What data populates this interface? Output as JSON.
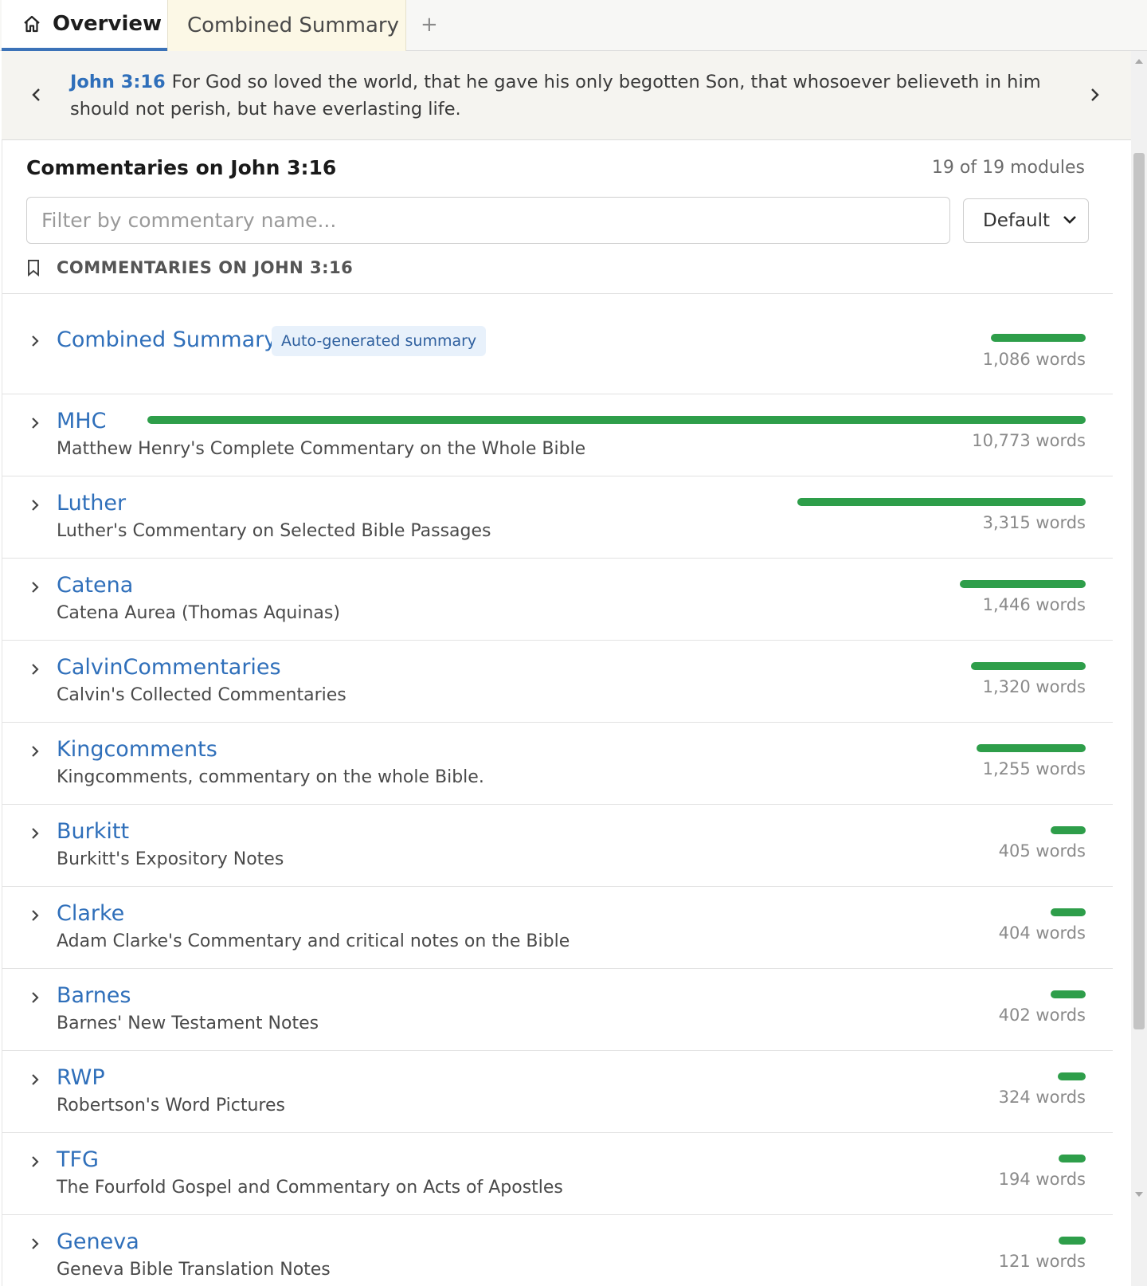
{
  "tabs": {
    "overview_label": "Overview",
    "summary_label": "Combined Summary",
    "add_label": "+"
  },
  "verse": {
    "reference": "John 3:16",
    "text": "For God so loved the world, that he gave his only begotten Son, that whosoever believeth in him should not perish, but have everlasting life."
  },
  "panel": {
    "title": "Commentaries on John 3:16",
    "module_count": "19 of 19 modules",
    "filter_placeholder": "Filter by commentary name...",
    "sort_value": "Default",
    "section_heading": "COMMENTARIES ON JOHN 3:16"
  },
  "accent_color": "#2f6fba",
  "bar_color": "#2e9e4a",
  "commentaries": [
    {
      "name": "Combined Summary",
      "badge": "Auto-generated summary",
      "words": "1,086 words",
      "word_count": 1086
    },
    {
      "name": "MHC",
      "description": "Matthew Henry's Complete Commentary on the Whole Bible",
      "words": "10,773 words",
      "word_count": 10773
    },
    {
      "name": "Luther",
      "description": "Luther's Commentary on Selected Bible Passages",
      "words": "3,315 words",
      "word_count": 3315
    },
    {
      "name": "Catena",
      "description": "Catena Aurea (Thomas Aquinas)",
      "words": "1,446 words",
      "word_count": 1446
    },
    {
      "name": "CalvinCommentaries",
      "description": "Calvin's Collected Commentaries",
      "words": "1,320 words",
      "word_count": 1320
    },
    {
      "name": "Kingcomments",
      "description": "Kingcomments, commentary on the whole Bible.",
      "words": "1,255 words",
      "word_count": 1255
    },
    {
      "name": "Burkitt",
      "description": "Burkitt's Expository Notes",
      "words": "405 words",
      "word_count": 405
    },
    {
      "name": "Clarke",
      "description": "Adam Clarke's Commentary and critical notes on the Bible",
      "words": "404 words",
      "word_count": 404
    },
    {
      "name": "Barnes",
      "description": "Barnes' New Testament Notes",
      "words": "402 words",
      "word_count": 402
    },
    {
      "name": "RWP",
      "description": "Robertson's Word Pictures",
      "words": "324 words",
      "word_count": 324
    },
    {
      "name": "TFG",
      "description": "The Fourfold Gospel and Commentary on Acts of Apostles",
      "words": "194 words",
      "word_count": 194
    },
    {
      "name": "Geneva",
      "description": "Geneva Bible Translation Notes",
      "words": "121 words",
      "word_count": 121
    }
  ]
}
